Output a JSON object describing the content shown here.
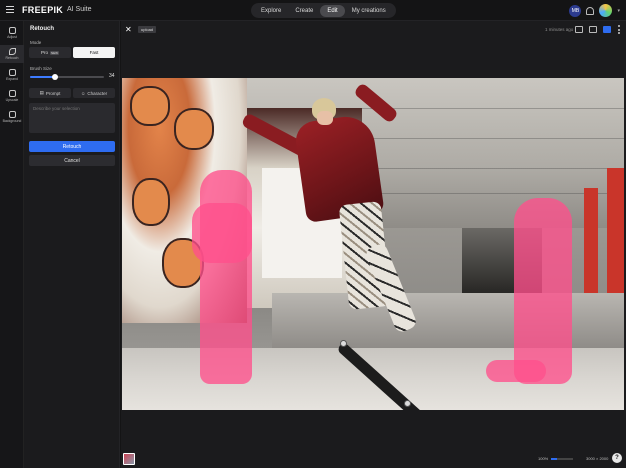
{
  "app": {
    "logo": "FREEPIK",
    "suite": "AI Suite"
  },
  "nav": {
    "tabs": [
      "Explore",
      "Create",
      "Edit",
      "My creations"
    ],
    "active": "Edit"
  },
  "header": {
    "user_initials": "MB"
  },
  "rail": {
    "items": [
      "Adjust",
      "Retouch",
      "Expand",
      "Upscale",
      "Background"
    ]
  },
  "panel": {
    "title": "Retouch",
    "mode_label": "Mode",
    "mode_pro": "Pro",
    "mode_pro_badge": "NEW",
    "mode_fast": "Fast",
    "brush_label": "Brush Size",
    "brush_value": "34",
    "brush_fraction": 0.34,
    "prompt_tab": "Prompt",
    "character_tab": "Character",
    "prompt_placeholder": "Describe your selection",
    "retouch_button": "Retouch",
    "cancel_button": "Cancel"
  },
  "canvas": {
    "tag": "upload",
    "time": "1 minutes ago",
    "zoom": "100%",
    "zoom_fraction": 0.25,
    "dims": "3000 × 2000"
  },
  "colors": {
    "accent": "#2e6cf0",
    "mask": "#ff508c"
  }
}
